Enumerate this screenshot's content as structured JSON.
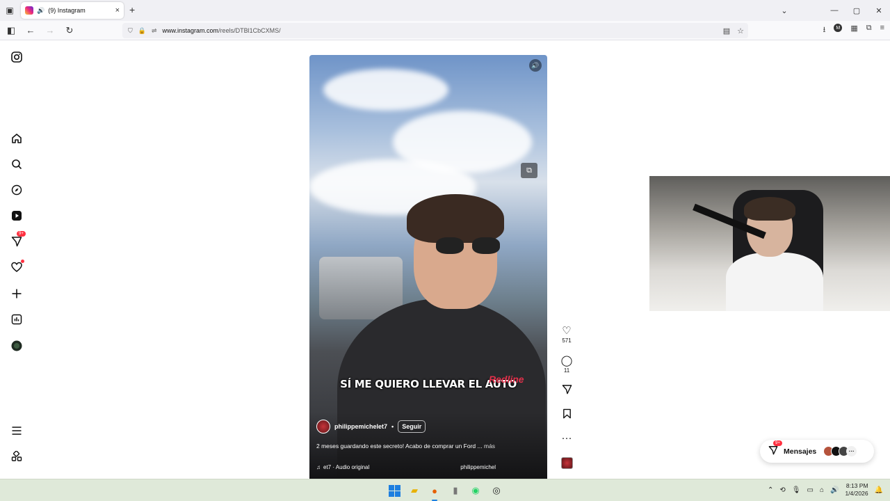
{
  "browser": {
    "tab_title": "(9) Instagram",
    "tab_close": "×",
    "new_tab": "+",
    "url_domain": "www.instagram.com",
    "url_path": "/reels/DTBl1CbCXMS/",
    "controls": {
      "minimize": "—",
      "maximize": "▢",
      "close": "✕",
      "list_all_tabs": "⌄"
    },
    "toolbar_profile_letter": "M"
  },
  "instagram": {
    "sidebar": {
      "notifications_badge": "9+",
      "items": [
        "instagram-logo-icon",
        "home-icon",
        "search-icon",
        "explore-icon",
        "reels-icon",
        "messages-icon",
        "notifications-icon",
        "create-icon",
        "dashboard-icon",
        "profile-icon",
        "more-menu-icon",
        "meta-apps-icon"
      ]
    },
    "reel": {
      "subtitle": "SÍ ME QUIERO LLEVAR EL AUTO",
      "shirt_brand": "Redline",
      "author": "philippemichelet7",
      "separator": "•",
      "follow_label": "Seguir",
      "caption": "2 meses guardando este secreto! Acabo de comprar un Ford ...",
      "caption_more": "más",
      "audio": "et7 · Audio original",
      "tagged_user": "philippemichel"
    },
    "actions": {
      "likes": "571",
      "comments": "11"
    },
    "messages": {
      "label": "Mensajes",
      "badge": "9+"
    }
  },
  "taskbar": {
    "time": "8:13 PM",
    "date": "1/4/2026"
  },
  "colors": {
    "accent_red": "#ff3040",
    "windows_blue": "#1d7fe0",
    "taskbar_bg": "#dfe9d9"
  }
}
